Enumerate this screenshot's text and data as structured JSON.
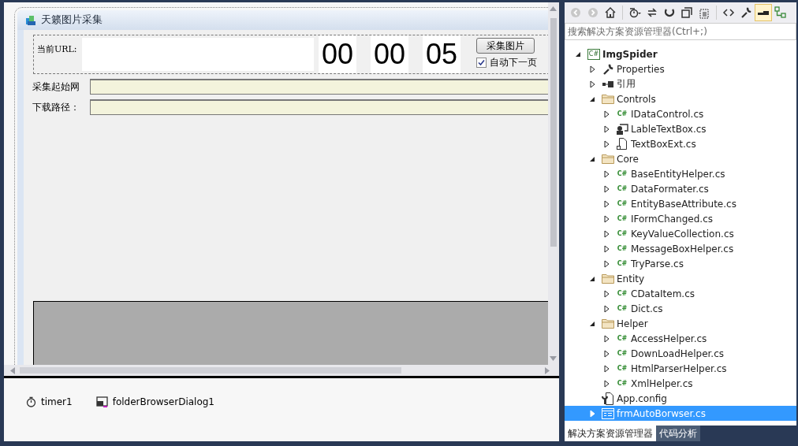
{
  "designer": {
    "form": {
      "title": "天籁图片采集",
      "url_label": "当前URL:",
      "timer_digits": [
        "00",
        "00",
        "05"
      ],
      "capture_button": "采集图片",
      "auto_next": {
        "label": "自动下一页",
        "checked": true
      },
      "fields": [
        {
          "label": "采集起始网"
        },
        {
          "label": "下载路径："
        }
      ]
    },
    "tray": [
      {
        "kind": "timer",
        "label": "timer1"
      },
      {
        "kind": "folder-dialog",
        "label": "folderBrowserDialog1"
      }
    ]
  },
  "solution_explorer": {
    "search": {
      "placeholder": "搜索解决方案资源管理器(Ctrl+;)"
    },
    "toolbar": [
      {
        "kind": "back",
        "selected": false
      },
      {
        "kind": "forward",
        "selected": false
      },
      {
        "kind": "home",
        "selected": false
      },
      {
        "kind": "history",
        "selected": false
      },
      {
        "kind": "sync",
        "selected": false
      },
      {
        "kind": "refresh",
        "selected": false
      },
      {
        "kind": "collapse",
        "selected": false
      },
      {
        "kind": "show-all",
        "selected": false
      },
      {
        "kind": "code",
        "selected": false
      },
      {
        "kind": "properties",
        "selected": false
      },
      {
        "kind": "pin",
        "selected": true
      },
      {
        "kind": "diagram",
        "selected": false
      }
    ],
    "tree": [
      {
        "label": "ImgSpider",
        "kind": "project",
        "badge": "C#",
        "expandable": true,
        "expanded": true,
        "selected": false,
        "children": [
          {
            "label": "Properties",
            "kind": "wrench",
            "expandable": true,
            "expanded": false,
            "selected": false
          },
          {
            "label": "引用",
            "kind": "references",
            "expandable": true,
            "expanded": false,
            "selected": false
          },
          {
            "label": "Controls",
            "kind": "folder",
            "expandable": true,
            "expanded": true,
            "selected": false,
            "children": [
              {
                "label": "IDataControl.cs",
                "kind": "cs",
                "badge": "C#",
                "expandable": true,
                "expanded": false,
                "selected": false
              },
              {
                "label": "LableTextBox.cs",
                "kind": "usercontrol",
                "expandable": true,
                "expanded": false,
                "selected": false
              },
              {
                "label": "TextBoxExt.cs",
                "kind": "component",
                "expandable": true,
                "expanded": false,
                "selected": false
              }
            ]
          },
          {
            "label": "Core",
            "kind": "folder",
            "expandable": true,
            "expanded": true,
            "selected": false,
            "children": [
              {
                "label": "BaseEntityHelper.cs",
                "kind": "cs",
                "badge": "C#",
                "expandable": true,
                "expanded": false,
                "selected": false
              },
              {
                "label": "DataFormater.cs",
                "kind": "cs",
                "badge": "C#",
                "expandable": true,
                "expanded": false,
                "selected": false
              },
              {
                "label": "EntityBaseAttribute.cs",
                "kind": "cs",
                "badge": "C#",
                "expandable": true,
                "expanded": false,
                "selected": false
              },
              {
                "label": "IFormChanged.cs",
                "kind": "cs",
                "badge": "C#",
                "expandable": true,
                "expanded": false,
                "selected": false
              },
              {
                "label": "KeyValueCollection.cs",
                "kind": "cs",
                "badge": "C#",
                "expandable": true,
                "expanded": false,
                "selected": false
              },
              {
                "label": "MessageBoxHelper.cs",
                "kind": "cs",
                "badge": "C#",
                "expandable": true,
                "expanded": false,
                "selected": false
              },
              {
                "label": "TryParse.cs",
                "kind": "cs",
                "badge": "C#",
                "expandable": true,
                "expanded": false,
                "selected": false
              }
            ]
          },
          {
            "label": "Entity",
            "kind": "folder",
            "expandable": true,
            "expanded": true,
            "selected": false,
            "children": [
              {
                "label": "CDataItem.cs",
                "kind": "cs",
                "badge": "C#",
                "expandable": true,
                "expanded": false,
                "selected": false
              },
              {
                "label": "Dict.cs",
                "kind": "cs",
                "badge": "C#",
                "expandable": true,
                "expanded": false,
                "selected": false
              }
            ]
          },
          {
            "label": "Helper",
            "kind": "folder",
            "expandable": true,
            "expanded": true,
            "selected": false,
            "children": [
              {
                "label": "AccessHelper.cs",
                "kind": "cs",
                "badge": "C#",
                "expandable": true,
                "expanded": false,
                "selected": false
              },
              {
                "label": "DownLoadHelper.cs",
                "kind": "cs",
                "badge": "C#",
                "expandable": true,
                "expanded": false,
                "selected": false
              },
              {
                "label": "HtmlParserHelper.cs",
                "kind": "cs",
                "badge": "C#",
                "expandable": true,
                "expanded": false,
                "selected": false
              },
              {
                "label": "XmlHelper.cs",
                "kind": "cs",
                "badge": "C#",
                "expandable": true,
                "expanded": false,
                "selected": false
              }
            ]
          },
          {
            "label": "App.config",
            "kind": "config",
            "expandable": false,
            "selected": false
          },
          {
            "label": "frmAutoBorwser.cs",
            "kind": "form",
            "expandable": true,
            "expanded": false,
            "selected": true
          }
        ]
      }
    ],
    "tabs": [
      {
        "label": "解决方案资源管理器",
        "selected": true
      },
      {
        "label": "代码分析",
        "selected": false
      }
    ]
  }
}
